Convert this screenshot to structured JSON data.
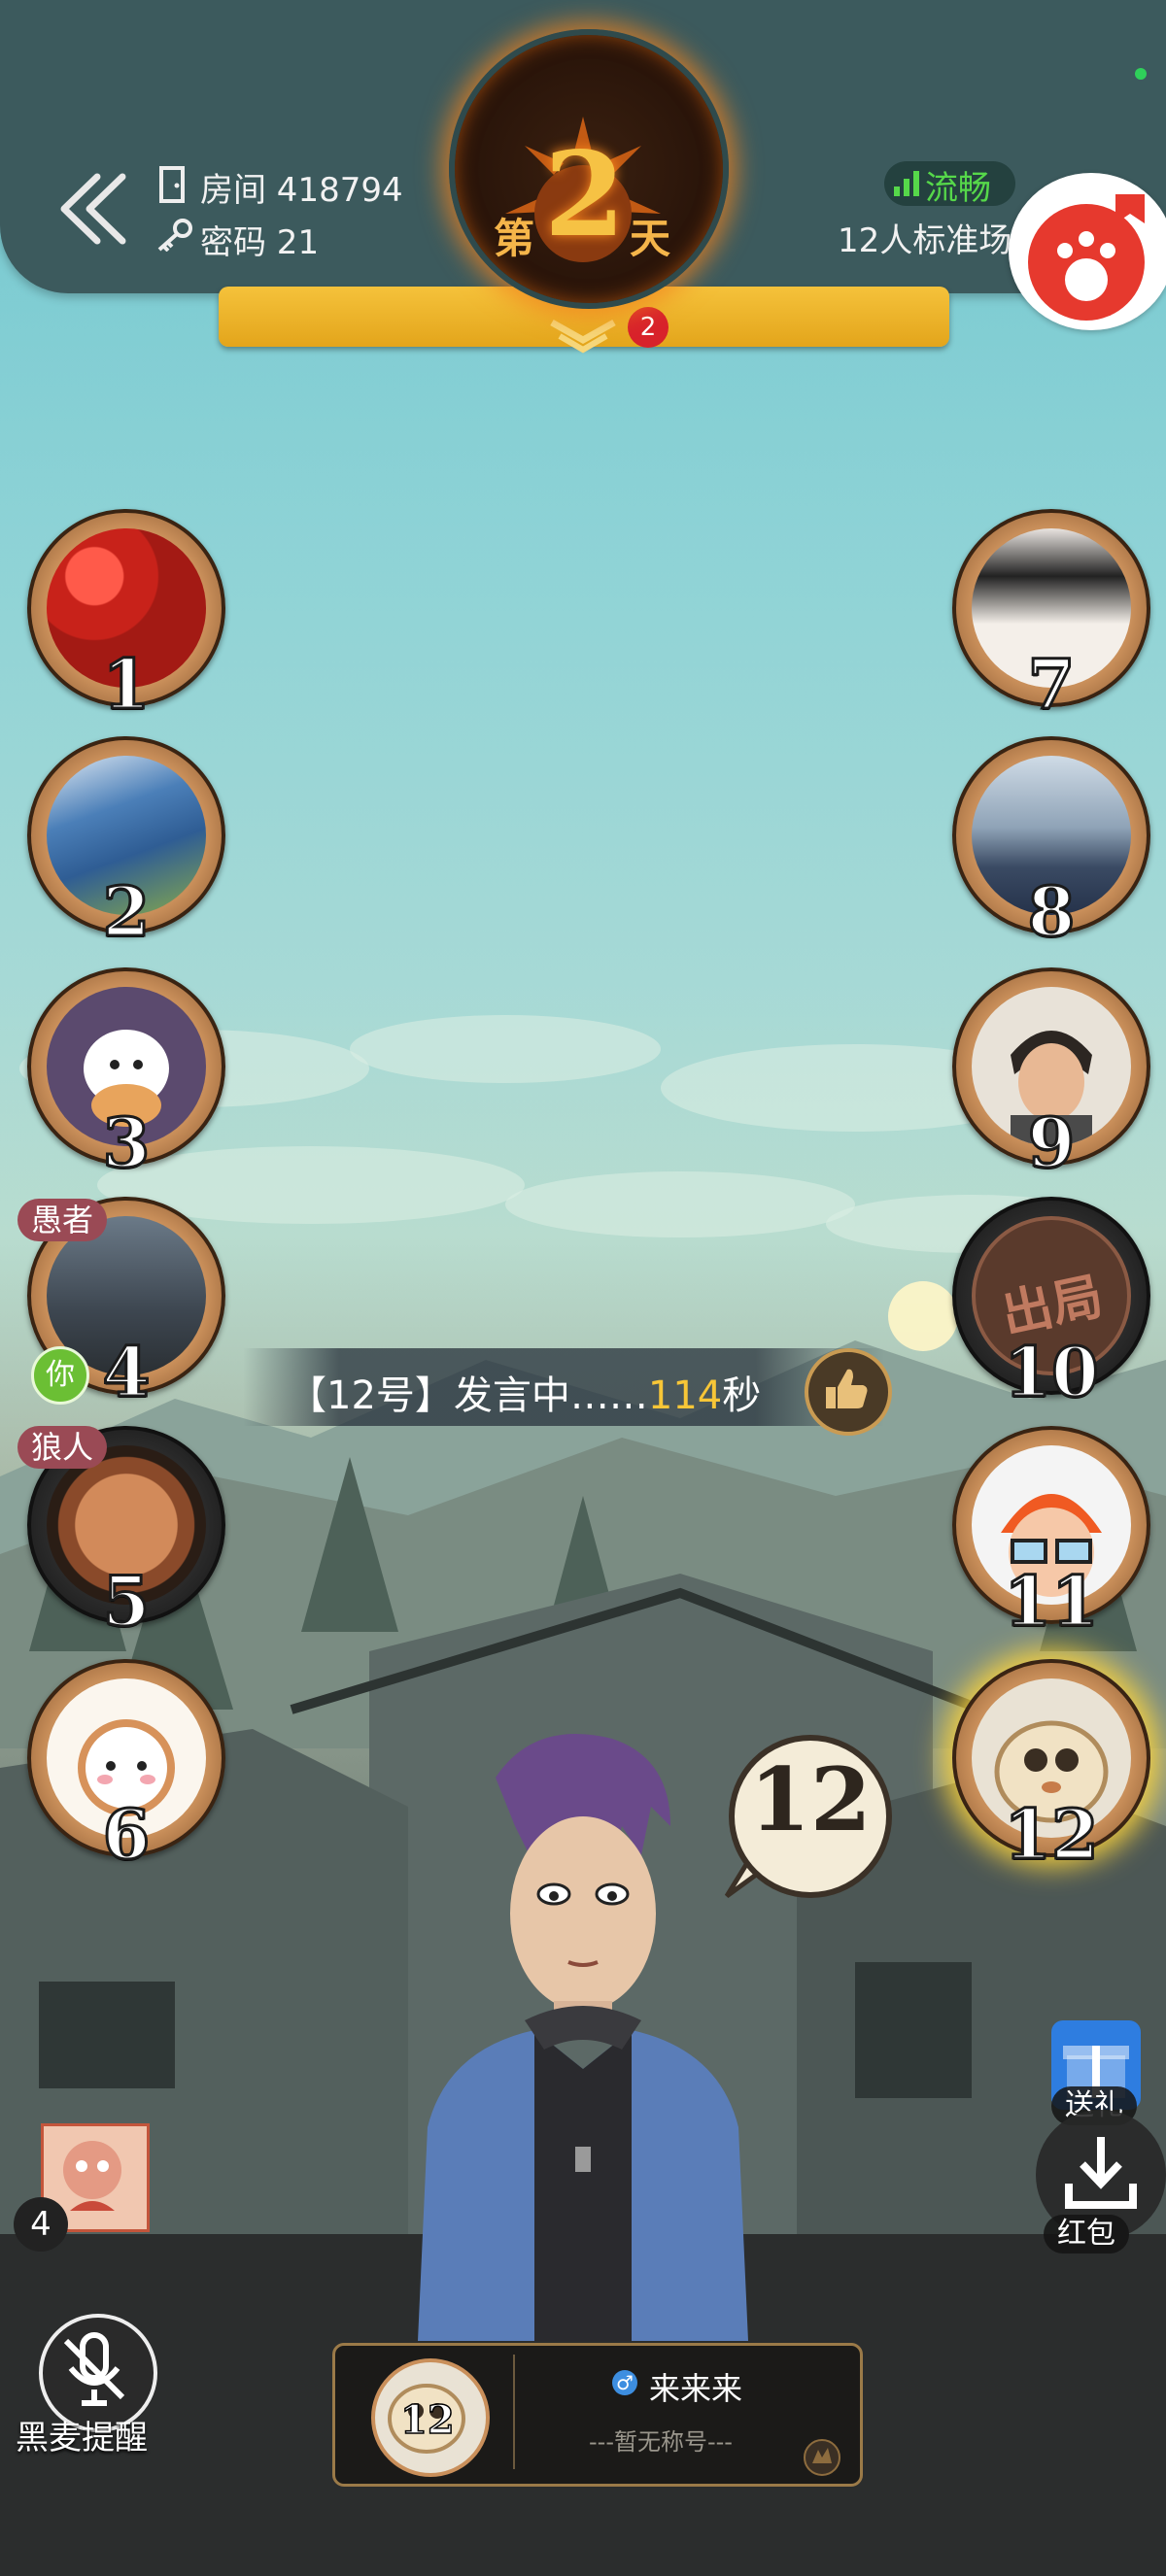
{
  "header": {
    "room_label": "房间 418794",
    "password_label": "密码 21",
    "day_prefix": "第",
    "day_number": "2",
    "day_suffix": "天",
    "network_status": "流畅",
    "network_status_color": "#56d84a",
    "game_mode": "12人标准场",
    "notification_count": "2"
  },
  "seats": [
    {
      "num": "1",
      "side": "left",
      "avatar": "strawberries"
    },
    {
      "num": "2",
      "side": "left",
      "avatar": "mountain-lake"
    },
    {
      "num": "3",
      "side": "left",
      "avatar": "cartoon-dog"
    },
    {
      "num": "4",
      "side": "left",
      "avatar": "sunset-balcony",
      "tag": "愚者",
      "you": "你"
    },
    {
      "num": "5",
      "side": "left",
      "avatar": "eliminated-explosion",
      "tag": "狼人"
    },
    {
      "num": "6",
      "side": "left",
      "avatar": "cartoon-bear"
    },
    {
      "num": "7",
      "side": "right",
      "avatar": "girl-photo"
    },
    {
      "num": "8",
      "side": "right",
      "avatar": "mountain-aerial"
    },
    {
      "num": "9",
      "side": "right",
      "avatar": "anime-boy"
    },
    {
      "num": "10",
      "side": "right",
      "avatar": "out-stamp",
      "status": "出局"
    },
    {
      "num": "11",
      "side": "right",
      "avatar": "glasses-man"
    },
    {
      "num": "12",
      "side": "right",
      "avatar": "bun-character",
      "speaking": true
    }
  ],
  "speaking_bar": {
    "text": "【12号】发言中……",
    "seconds": "114",
    "unit": "秒",
    "seconds_color": "#f7c637"
  },
  "speech_bubble_number": "12",
  "side_buttons": {
    "gift_label": "送礼",
    "redpacket_label": "红包"
  },
  "mini_card_count": "4",
  "mic_label": "黑麦提醒",
  "player_card": {
    "seat_number": "12",
    "gender_icon": "male-icon",
    "name": "来来来",
    "title": "---暂无称号---"
  }
}
